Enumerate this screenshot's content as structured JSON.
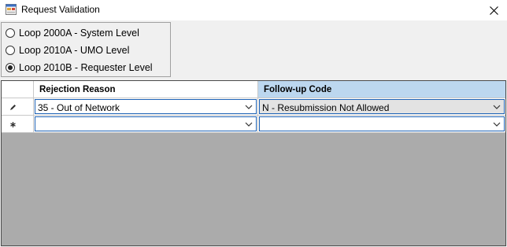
{
  "window": {
    "title": "Request Validation",
    "icon": "form-app-icon",
    "close_icon": "close-icon"
  },
  "loop_options": [
    {
      "label": "Loop 2000A - System Level",
      "checked": false
    },
    {
      "label": "Loop 2010A - UMO Level",
      "checked": false
    },
    {
      "label": "Loop 2010B - Requester Level",
      "checked": true
    }
  ],
  "grid": {
    "columns": [
      "Rejection Reason",
      "Follow-up Code"
    ],
    "rows": [
      {
        "indicator": "pencil-edit-icon",
        "rejection_reason": "35 - Out of Network",
        "follow_up_code": "N - Resubmission Not Allowed"
      },
      {
        "indicator": "new-row-asterisk-icon",
        "rejection_reason": "",
        "follow_up_code": ""
      }
    ]
  },
  "colors": {
    "selected_header": "#bcd7ef",
    "grid_background": "#ababab",
    "focus_border": "#1e62b5"
  }
}
